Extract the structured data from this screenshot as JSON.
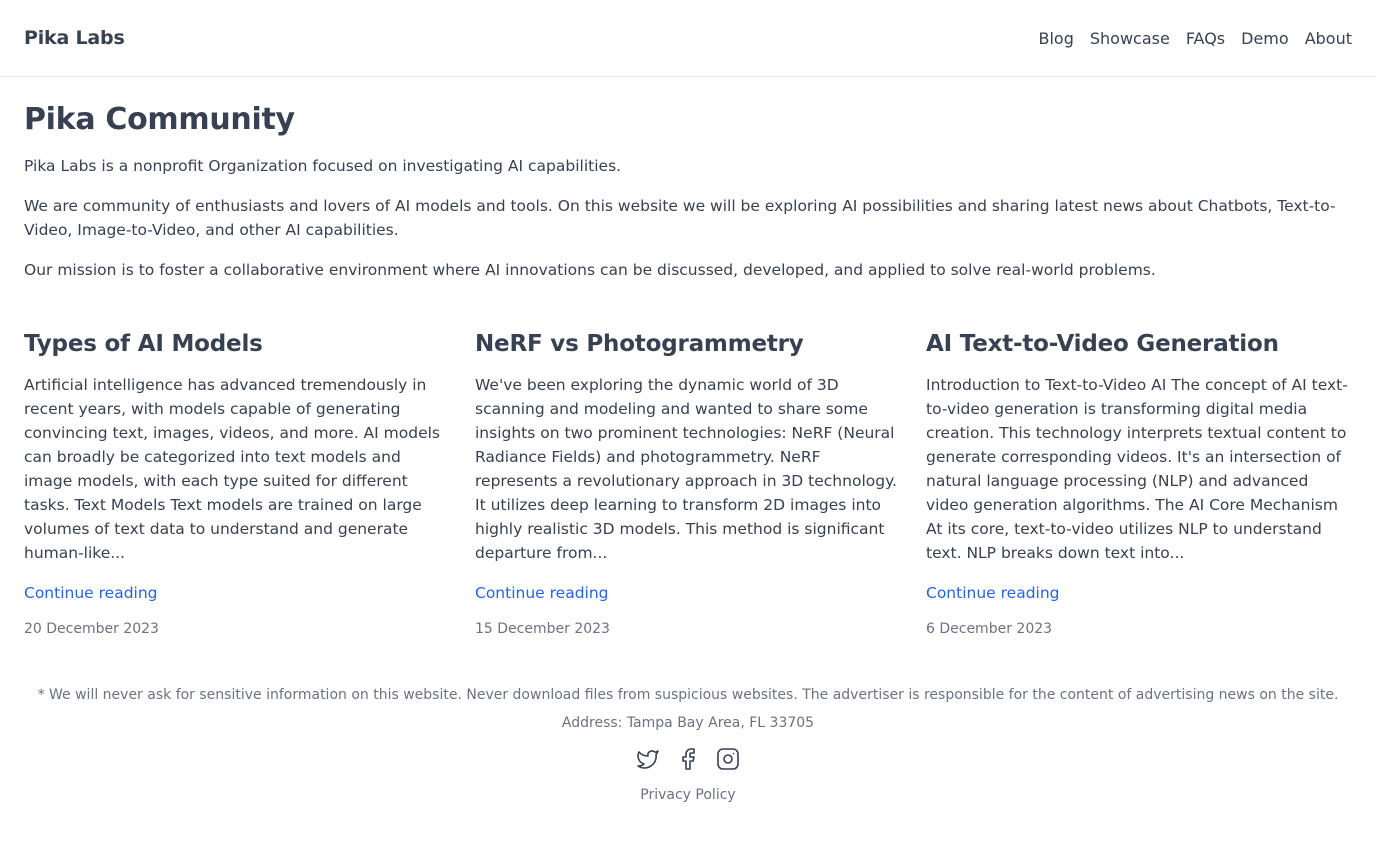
{
  "header": {
    "brand": "Pika Labs",
    "nav": [
      "Blog",
      "Showcase",
      "FAQs",
      "Demo",
      "About"
    ]
  },
  "intro": {
    "title": "Pika Community",
    "paragraphs": [
      "Pika Labs is a nonprofit Organization focused on investigating AI capabilities.",
      "We are community of enthusiasts and lovers of AI models and tools. On this website we will be exploring AI possibilities and sharing latest news about Chatbots, Text-to-Video, Image-to-Video, and other AI capabilities.",
      "Our mission is to foster a collaborative environment where AI innovations can be discussed, developed, and applied to solve real-world problems."
    ]
  },
  "posts": [
    {
      "title": "Types of AI Models",
      "excerpt": "Artificial intelligence has advanced tremendously in recent years, with models capable of generating convincing text, images, videos, and more. AI models can broadly be categorized into text models and image models, with each type suited for different tasks. Text Models Text models are trained on large volumes of text data to understand and generate human-like...",
      "link_label": "Continue reading",
      "date": "20 December 2023"
    },
    {
      "title": "NeRF vs Photogrammetry",
      "excerpt": "We've been exploring the dynamic world of 3D scanning and modeling and wanted to share some insights on two prominent technologies: NeRF (Neural Radiance Fields) and photogrammetry. NeRF represents a revolutionary approach in 3D technology. It utilizes deep learning to transform 2D images into highly realistic 3D models. This method is significant departure from...",
      "link_label": "Continue reading",
      "date": "15 December 2023"
    },
    {
      "title": "AI Text-to-Video Generation",
      "excerpt": "Introduction to Text-to-Video AI The concept of AI text-to-video generation is transforming digital media creation. This technology interprets textual content to generate corresponding videos. It's an intersection of natural language processing (NLP) and advanced video generation algorithms. The AI Core Mechanism At its core, text-to-video utilizes NLP to understand text. NLP breaks down text into...",
      "link_label": "Continue reading",
      "date": "6 December 2023"
    }
  ],
  "footer": {
    "disclaimer": "* We will never ask for sensitive information on this website. Never download files from suspicious websites. The advertiser is responsible for the content of advertising news on the site.",
    "address": "Address: Tampa Bay Area, FL 33705",
    "socials": [
      "twitter-icon",
      "facebook-icon",
      "instagram-icon"
    ],
    "privacy": "Privacy Policy"
  },
  "colors": {
    "text": "#374151",
    "muted": "#6b7280",
    "link": "#2563eb",
    "border": "#e5e7eb"
  }
}
